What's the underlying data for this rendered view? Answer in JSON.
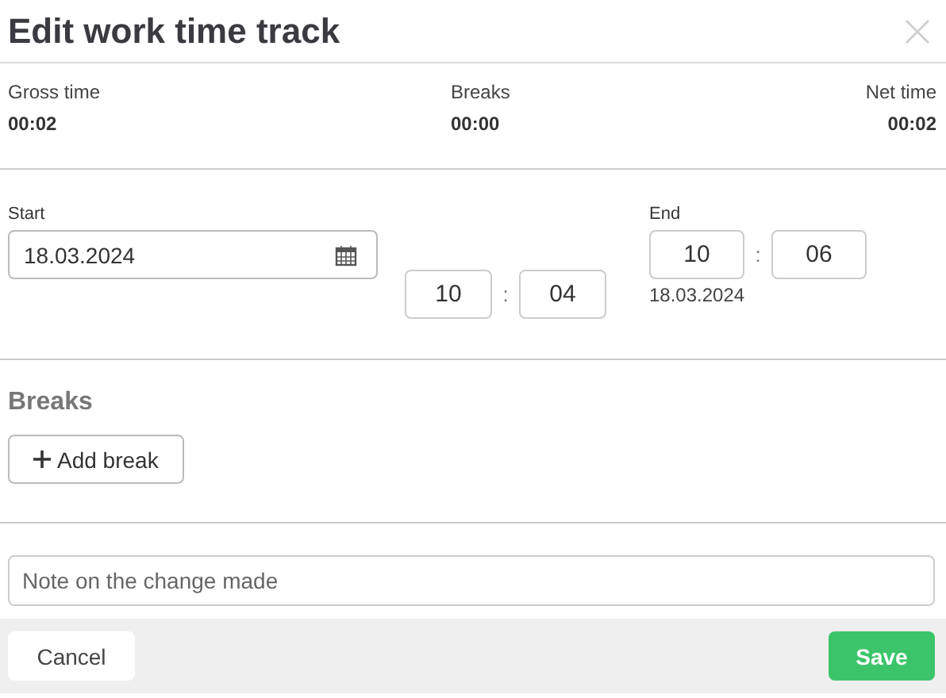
{
  "window": {
    "title": "Edit work time track"
  },
  "summary": [
    {
      "label": "Gross time",
      "value": "00:02"
    },
    {
      "label": "Breaks",
      "value": "00:00"
    },
    {
      "label": "Net time",
      "value": "00:02"
    }
  ],
  "start": {
    "label": "Start",
    "date": "18.03.2024",
    "hour": "10",
    "minute": "04",
    "separator": ":"
  },
  "end": {
    "label": "End",
    "hour": "10",
    "minute": "06",
    "separator": ":",
    "date": "18.03.2024"
  },
  "breaks": {
    "heading": "Breaks",
    "add_button": "Add break"
  },
  "note": {
    "placeholder": "Note on the change made"
  },
  "buttons": {
    "cancel": "Cancel",
    "save": "Save"
  }
}
